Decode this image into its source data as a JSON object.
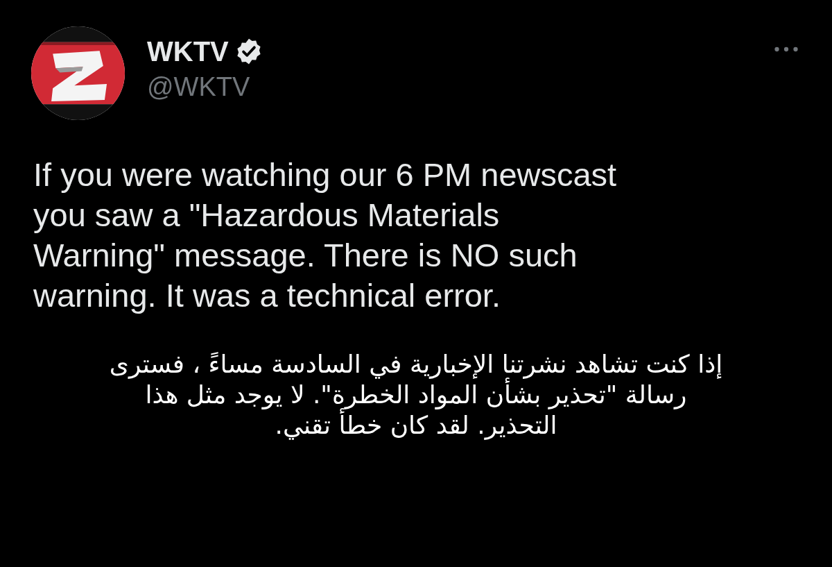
{
  "tweet": {
    "author": {
      "name": "WKTV",
      "verified": true,
      "handle": "@WKTV"
    },
    "text_lines": [
      "If you were watching our 6 PM newscast",
      "you saw a \"Hazardous Materials",
      "Warning\" message. There is NO such",
      "warning. It was a technical error."
    ]
  },
  "caption": {
    "lines": [
      "إذا كنت تشاهد نشرتنا الإخبارية في السادسة مساءً ، فسترى",
      "رسالة \"تحذير بشأن المواد الخطرة\". لا يوجد مثل هذا",
      "التحذير. لقد كان خطأ تقني."
    ]
  }
}
